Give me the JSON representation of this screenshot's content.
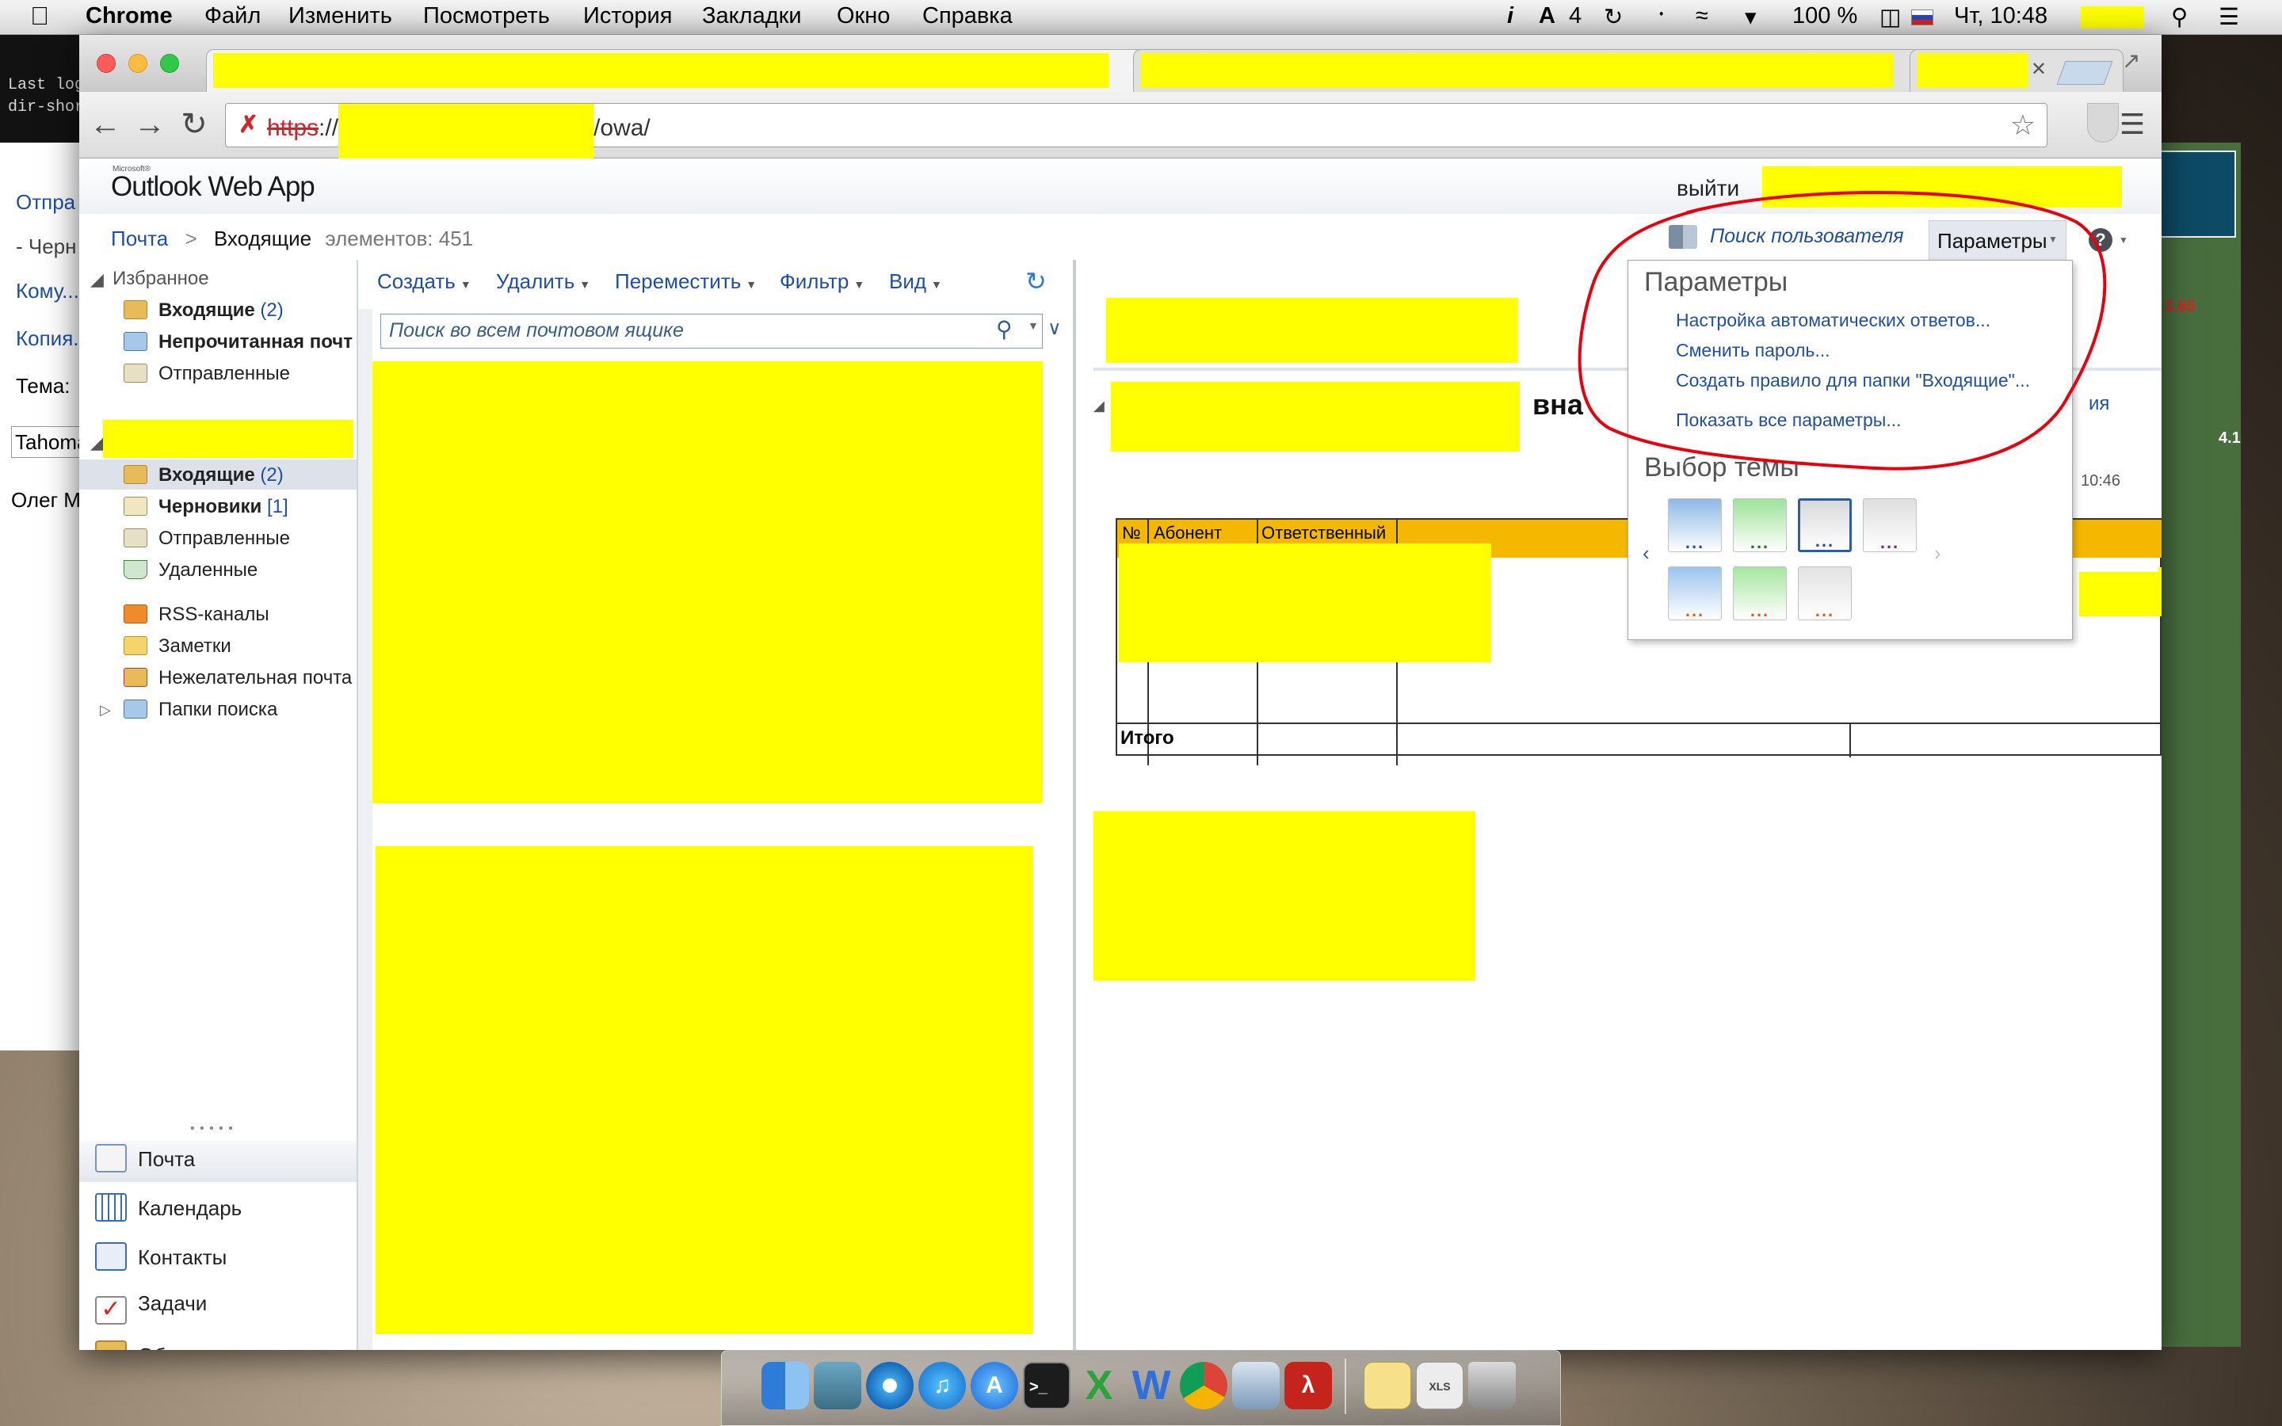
{
  "macos_menubar": {
    "app_name": "Chrome",
    "menus": [
      "Файл",
      "Изменить",
      "Посмотреть",
      "История",
      "Закладки",
      "Окно",
      "Справка"
    ],
    "adobe_badge": "4",
    "battery": "100 %",
    "clock": "Чт, 10:48"
  },
  "terminal": {
    "lines": [
      "Last log",
      "dir-shor"
    ]
  },
  "back_window": {
    "items": [
      "Отпра",
      "- Черн",
      "Кому...",
      "Копия...",
      "Тема:",
      "Tahoma",
      "Олег М"
    ]
  },
  "right_strip": {
    "text_1": "3.65",
    "text_2": "4.1"
  },
  "browser": {
    "url_scheme": "https",
    "url_sep": "://",
    "url_path": "/owa/"
  },
  "owa": {
    "logo_small": "Microsoft®",
    "logo": "Outlook Web App",
    "signout": "выйти",
    "breadcrumb": {
      "root": "Почта",
      "sep": ">",
      "current": "Входящие",
      "count_label": "элементов: 451"
    },
    "find_user": "Поиск пользователя",
    "options_button": "Параметры",
    "favorites": {
      "title": "Избранное",
      "items": [
        {
          "label": "Входящие",
          "count": "(2)"
        },
        {
          "label": "Непрочитанная почт",
          "count": ""
        },
        {
          "label": "Отправленные",
          "count": ""
        }
      ]
    },
    "mailbox_items": [
      {
        "label": "Входящие",
        "count": "(2)"
      },
      {
        "label": "Черновики",
        "count": "[1]"
      },
      {
        "label": "Отправленные",
        "count": ""
      },
      {
        "label": "Удаленные",
        "count": ""
      },
      {
        "label": "RSS-каналы",
        "count": ""
      },
      {
        "label": "Заметки",
        "count": ""
      },
      {
        "label": "Нежелательная почта",
        "count": ""
      },
      {
        "label": "Папки поиска",
        "count": ""
      }
    ],
    "resize_dots": "• • • • •",
    "nav": [
      "Почта",
      "Календарь",
      "Контакты",
      "Задачи",
      "Общие папки"
    ],
    "toolbar": [
      "Создать",
      "Удалить",
      "Переместить",
      "Фильтр",
      "Вид"
    ],
    "search_placeholder": "Поиск во всем почтовом ящике",
    "reading": {
      "title_fragment": "вна",
      "action_fragment": "ия",
      "time": "10:46",
      "table_headers": [
        "№",
        "Абонент",
        "Ответственный"
      ],
      "total_label": "Итого"
    },
    "options_menu": {
      "title": "Параметры",
      "links": [
        "Настройка автоматических ответов...",
        "Сменить пароль...",
        "Создать правило для папки \"Входящие\"...",
        "Показать все параметры..."
      ],
      "theme_title": "Выбор темы",
      "themes": [
        {
          "color": "#8fb8e6",
          "dots": "#1f4fa3",
          "selected": false
        },
        {
          "color": "#9ee29a",
          "dots": "#1b7a1b",
          "selected": false
        },
        {
          "color": "#d9d9d9",
          "dots": "#1f4fa3",
          "selected": true
        },
        {
          "color": "#dedede",
          "dots": "#8a1c8a",
          "selected": false
        },
        {
          "color": "#9cc4ee",
          "dots": "#e0601a",
          "selected": false
        },
        {
          "color": "#a6e6a0",
          "dots": "#e0601a",
          "selected": false
        },
        {
          "color": "#e2e2e2",
          "dots": "#e0601a",
          "selected": false
        }
      ]
    }
  },
  "annotation_color": "#e8000d"
}
